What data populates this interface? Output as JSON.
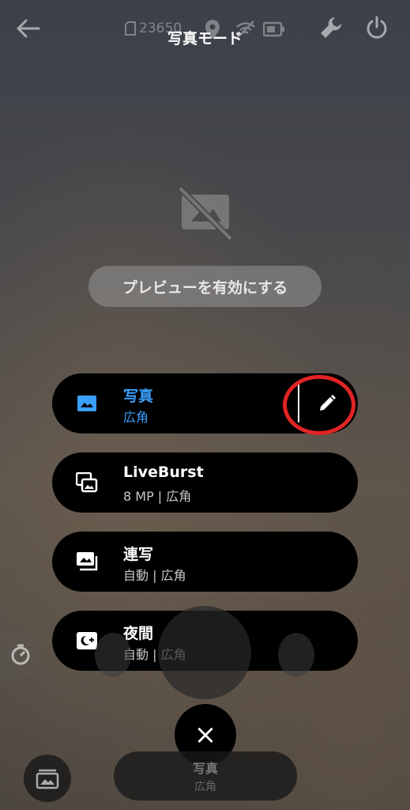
{
  "topbar": {
    "title": "写真モード",
    "storage_count": "23650",
    "icons": [
      "back-arrow-icon",
      "sd-card-icon",
      "location-icon",
      "wifi-off-icon",
      "battery-icon",
      "wrench-icon",
      "power-icon"
    ]
  },
  "preview": {
    "disabled_icon": "preview-off-icon",
    "enable_button_label": "プレビューを有効にする"
  },
  "modes": [
    {
      "name": "写真",
      "detail": "広角",
      "icon": "photo-icon",
      "selected": true
    },
    {
      "name": "LiveBurst",
      "detail": "8 MP | 広角",
      "icon": "liveburst-icon",
      "selected": false
    },
    {
      "name": "連写",
      "detail": "自動 | 広角",
      "icon": "burst-icon",
      "selected": false
    },
    {
      "name": "夜間",
      "detail": "自動 | 広角",
      "icon": "night-icon",
      "selected": false
    }
  ],
  "bottom": {
    "close_symbol": "×",
    "current_mode_title": "写真",
    "current_mode_sub": "広角"
  },
  "colors": {
    "accent": "#3aa0ff",
    "highlight": "#e02424",
    "card": "#000000"
  }
}
